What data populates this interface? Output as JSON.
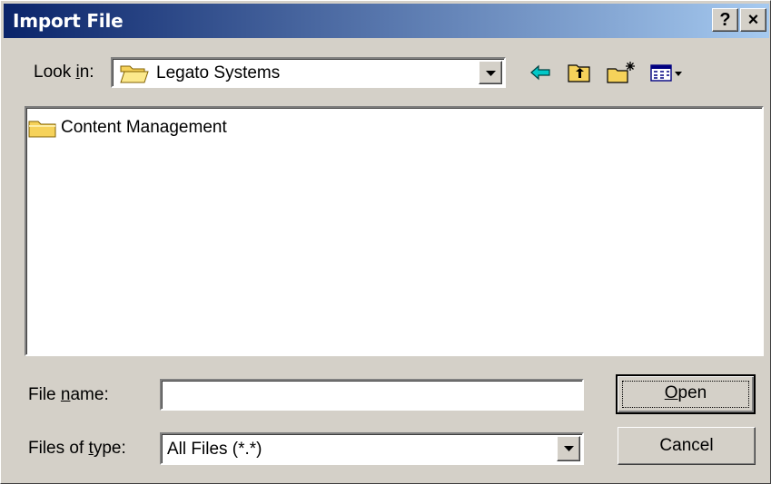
{
  "window": {
    "title": "Import File",
    "help_btn": "?",
    "close_btn": "×"
  },
  "lookin": {
    "label_pre": "Look ",
    "label_key": "i",
    "label_post": "n:",
    "value": "Legato Systems"
  },
  "toolbar": {
    "icons": [
      "back-arrow-icon",
      "up-one-level-icon",
      "new-folder-icon",
      "view-menu-icon"
    ]
  },
  "files": [
    {
      "name": "Content Management",
      "type": "folder"
    }
  ],
  "filename": {
    "label_pre": "File ",
    "label_key": "n",
    "label_post": "ame:",
    "value": ""
  },
  "filetype": {
    "label_pre": "Files of ",
    "label_key": "t",
    "label_post": "ype:",
    "value": "All Files (*.*)"
  },
  "buttons": {
    "open_key": "O",
    "open_rest": "pen",
    "cancel": "Cancel"
  },
  "colors": {
    "title_start": "#0a246a",
    "title_end": "#a6caf0",
    "folder": "#f6d25a",
    "arrow": "#00c8c8"
  }
}
